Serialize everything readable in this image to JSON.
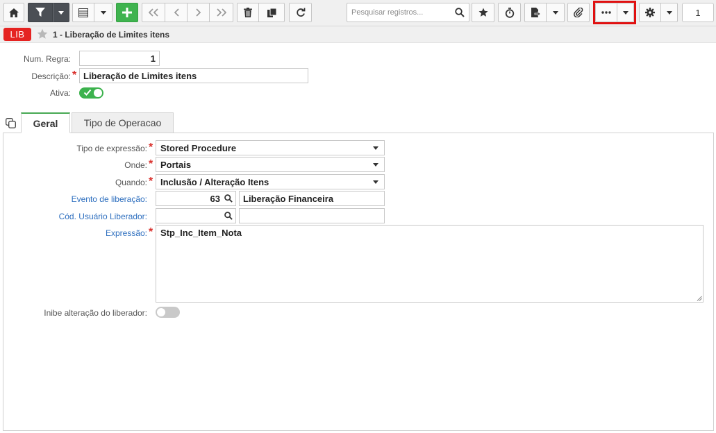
{
  "toolbar": {
    "search_placeholder": "Pesquisar registros...",
    "page_number": "1"
  },
  "titlebar": {
    "badge": "LIB",
    "title": "1 - Liberação de Limites itens"
  },
  "header_form": {
    "num_regra_label": "Num. Regra:",
    "num_regra_value": "1",
    "descricao_label": "Descrição:",
    "descricao_value": "Liberação de Limites itens",
    "ativa_label": "Ativa:",
    "ativa_on": true
  },
  "tabs": [
    {
      "label": "Geral",
      "active": true
    },
    {
      "label": "Tipo de Operacao",
      "active": false
    }
  ],
  "geral": {
    "tipo_expressao_label": "Tipo de expressão:",
    "tipo_expressao_value": "Stored Procedure",
    "onde_label": "Onde:",
    "onde_value": "Portais",
    "quando_label": "Quando:",
    "quando_value": "Inclusão / Alteração Itens",
    "evento_label": "Evento de liberação:",
    "evento_code": "63",
    "evento_desc": "Liberação Financeira",
    "cod_usuario_label": "Cód. Usuário Liberador:",
    "cod_usuario_code": "",
    "cod_usuario_desc": "",
    "expressao_label": "Expressão:",
    "expressao_value": "Stp_Inc_Item_Nota",
    "inibe_label": "Inibe alteração do liberador:",
    "inibe_on": false
  },
  "colors": {
    "accent_green": "#3fb34f",
    "badge_red": "#e52321",
    "highlight_red": "#e01010",
    "link_blue": "#2e6fbf"
  }
}
